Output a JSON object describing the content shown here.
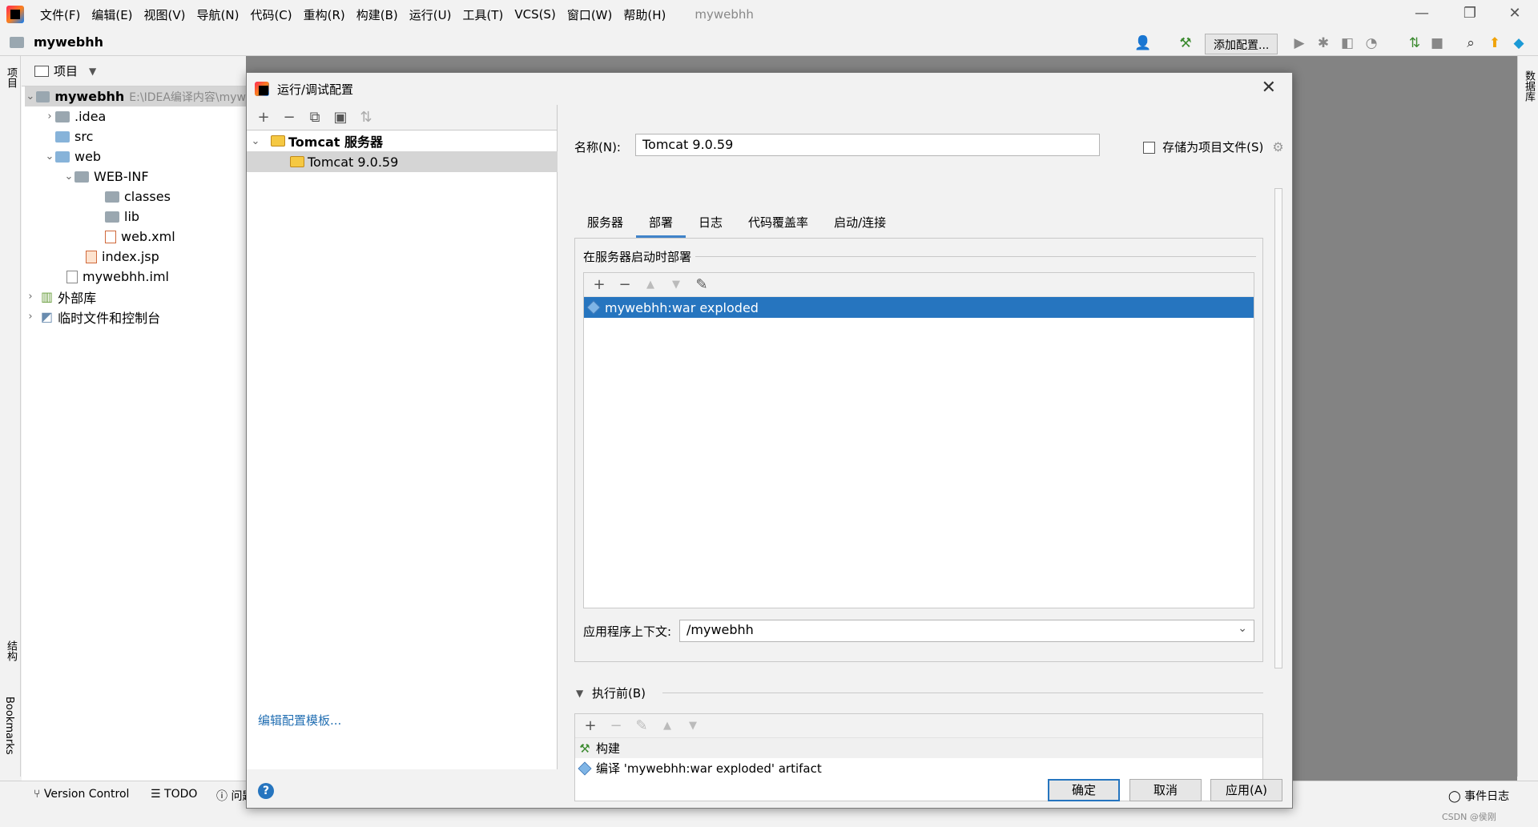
{
  "menubar": {
    "items": [
      "文件(F)",
      "编辑(E)",
      "视图(V)",
      "导航(N)",
      "代码(C)",
      "重构(R)",
      "构建(B)",
      "运行(U)",
      "工具(T)",
      "VCS(S)",
      "窗口(W)",
      "帮助(H)"
    ],
    "title": "mywebhh"
  },
  "navbar": {
    "project": "mywebhh",
    "add_config_label": "添加配置..."
  },
  "left_strip": {
    "project_tab": "项目",
    "structure_tab": "结构",
    "bookmarks_tab": "Bookmarks"
  },
  "right_strip": {
    "database_tab": "数据库"
  },
  "project_panel": {
    "header": "项目",
    "root_name": "mywebhh",
    "root_path": "E:\\IDEA编译内容\\myw",
    "items": [
      ".idea",
      "src",
      "web",
      "WEB-INF",
      "classes",
      "lib",
      "web.xml",
      "index.jsp",
      "mywebhh.iml",
      "外部库",
      "临时文件和控制台"
    ]
  },
  "statusbar": {
    "version_control": "Version Control",
    "todo": "TODO",
    "problems": "问题",
    "event_log": "事件日志",
    "watermark": "CSDN @侯刚"
  },
  "dialog": {
    "title": "运行/调试配置",
    "tree": {
      "category": "Tomcat 服务器",
      "config": "Tomcat 9.0.59"
    },
    "edit_templates": "编辑配置模板...",
    "name_label": "名称(N):",
    "name_value": "Tomcat 9.0.59",
    "store_as_project_file": "存储为项目文件(S)",
    "tabs": [
      "服务器",
      "部署",
      "日志",
      "代码覆盖率",
      "启动/连接"
    ],
    "active_tab": "部署",
    "deploy_section": "在服务器启动时部署",
    "deploy_items": [
      "mywebhh:war exploded"
    ],
    "app_context_label": "应用程序上下文:",
    "app_context_value": "/mywebhh",
    "before_launch_label": "执行前(B)",
    "before_launch_items": [
      "构建",
      "编译 'mywebhh:war exploded' artifact"
    ],
    "buttons": {
      "ok": "确定",
      "cancel": "取消",
      "apply": "应用(A)"
    }
  }
}
